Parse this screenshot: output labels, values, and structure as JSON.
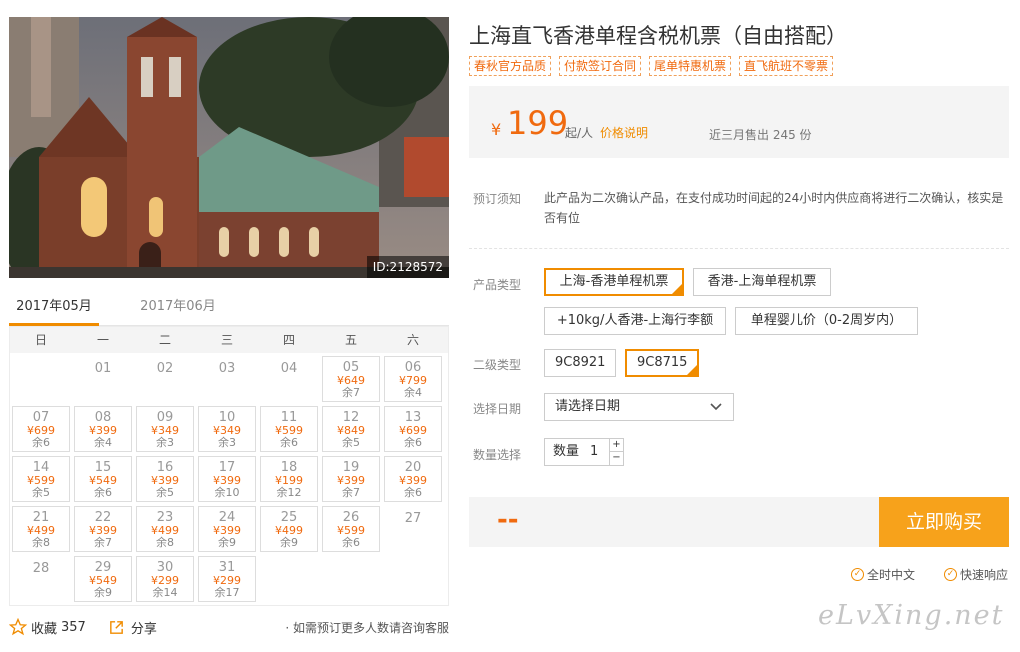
{
  "photo": {
    "id_label": "ID:2128572"
  },
  "calendar": {
    "tabs": [
      "2017年05月",
      "2017年06月"
    ],
    "weekdays": [
      "日",
      "一",
      "二",
      "三",
      "四",
      "五",
      "六"
    ],
    "days": [
      {
        "d": "01"
      },
      {
        "d": "02"
      },
      {
        "d": "03"
      },
      {
        "d": "04"
      },
      {
        "d": "05",
        "p": "¥649",
        "r": "余7"
      },
      {
        "d": "06",
        "p": "¥799",
        "r": "余4"
      },
      {
        "d": "07",
        "p": "¥699",
        "r": "余6"
      },
      {
        "d": "08",
        "p": "¥399",
        "r": "余4"
      },
      {
        "d": "09",
        "p": "¥349",
        "r": "余3"
      },
      {
        "d": "10",
        "p": "¥349",
        "r": "余3"
      },
      {
        "d": "11",
        "p": "¥599",
        "r": "余6"
      },
      {
        "d": "12",
        "p": "¥849",
        "r": "余5"
      },
      {
        "d": "13",
        "p": "¥699",
        "r": "余6"
      },
      {
        "d": "14",
        "p": "¥599",
        "r": "余5"
      },
      {
        "d": "15",
        "p": "¥549",
        "r": "余6"
      },
      {
        "d": "16",
        "p": "¥399",
        "r": "余5"
      },
      {
        "d": "17",
        "p": "¥399",
        "r": "余10"
      },
      {
        "d": "18",
        "p": "¥199",
        "r": "余12"
      },
      {
        "d": "19",
        "p": "¥399",
        "r": "余7"
      },
      {
        "d": "20",
        "p": "¥399",
        "r": "余6"
      },
      {
        "d": "21",
        "p": "¥499",
        "r": "余8"
      },
      {
        "d": "22",
        "p": "¥399",
        "r": "余7"
      },
      {
        "d": "23",
        "p": "¥499",
        "r": "余8"
      },
      {
        "d": "24",
        "p": "¥399",
        "r": "余9"
      },
      {
        "d": "25",
        "p": "¥499",
        "r": "余9"
      },
      {
        "d": "26",
        "p": "¥599",
        "r": "余6"
      },
      {
        "d": "27"
      },
      {
        "d": "28"
      },
      {
        "d": "29",
        "p": "¥549",
        "r": "余9"
      },
      {
        "d": "30",
        "p": "¥299",
        "r": "余14"
      },
      {
        "d": "31",
        "p": "¥299",
        "r": "余17"
      }
    ],
    "first_weekday": 1
  },
  "bottom": {
    "fav_label": "收藏",
    "fav_count": "357",
    "share_label": "分享",
    "hint": "· 如需预订更多人数请咨询客服"
  },
  "product": {
    "title": "上海直飞香港单程含税机票（自由搭配）",
    "tags": [
      "春秋官方品质",
      "付款签订合同",
      "尾单特惠机票",
      "直飞航班不零票"
    ]
  },
  "price": {
    "yen": "¥",
    "value": "199",
    "unit": "起/人",
    "note": "价格说明",
    "sold": "近三月售出 245 份"
  },
  "booking": {
    "notice_label": "预订须知",
    "notice_text": "此产品为二次确认产品，在支付成功时间起的24小时内供应商将进行二次确认，核实是否有位",
    "type_label": "产品类型",
    "types": [
      "上海-香港单程机票",
      "香港-上海单程机票",
      "+10kg/人香港-上海行李额",
      "单程婴儿价（0-2周岁内）"
    ],
    "sub_label": "二级类型",
    "subs": [
      "9C8921",
      "9C8715"
    ],
    "date_label": "选择日期",
    "date_placeholder": "请选择日期",
    "qty_label": "数量选择",
    "qty_field_label": "数量",
    "qty_value": "1",
    "qty_up": "+",
    "qty_down": "−"
  },
  "buy": {
    "total": "--",
    "button": "立即购买"
  },
  "guarantees": [
    "全时中文",
    "快速响应"
  ],
  "watermark": "eLvXing.net",
  "colors": {
    "accent": "#f08c00",
    "price": "#f06a0f",
    "buy_button": "#f7a21b"
  }
}
